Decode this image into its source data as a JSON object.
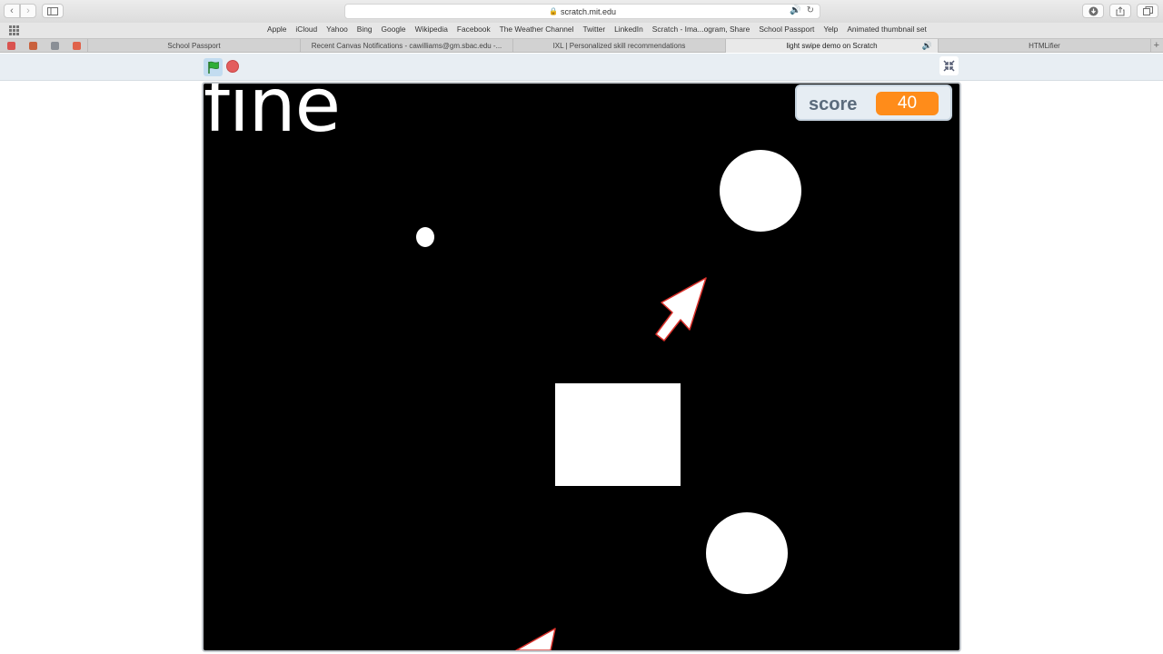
{
  "browser": {
    "url": "scratch.mit.edu",
    "favorites": [
      "Apple",
      "iCloud",
      "Yahoo",
      "Bing",
      "Google",
      "Wikipedia",
      "Facebook",
      "The Weather Channel",
      "Twitter",
      "LinkedIn",
      "Scratch - Ima...ogram, Share",
      "School Passport",
      "Yelp",
      "Animated thumbnail set"
    ],
    "tabs": [
      "School Passport",
      "Recent Canvas Notifications - cawilliams@gm.sbac.edu -...",
      "IXL | Personalized skill recommendations",
      "light swipe demo on Scratch",
      "HTMLifier"
    ],
    "active_tab": 3
  },
  "stage": {
    "text": "fine",
    "score_label": "score",
    "score_value": "40"
  },
  "colors": {
    "stage_bg": "#000000",
    "monitor_value_bg": "#ff8c1a",
    "stop": "#e35d5d",
    "flag": "#2eae37",
    "arrow_outline": "#d9302a"
  }
}
